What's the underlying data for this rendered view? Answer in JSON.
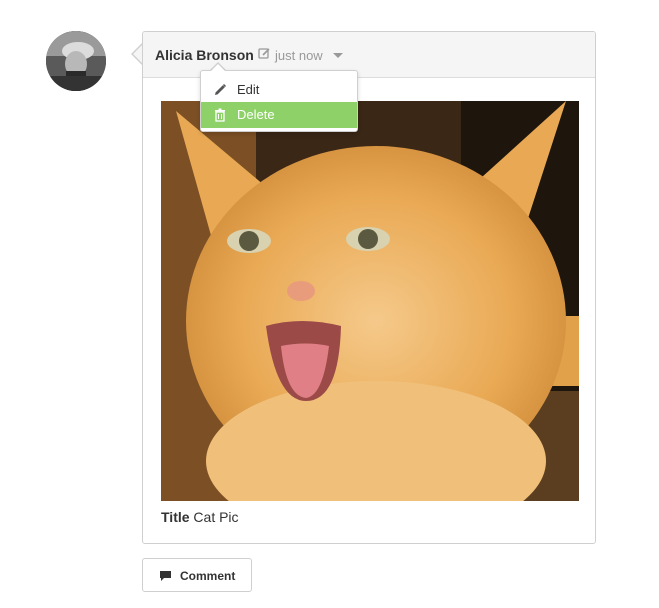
{
  "post": {
    "author": "Alicia Bronson",
    "timestamp": "just now",
    "image_alt": "cat photo",
    "caption_label": "Title",
    "caption_value": "Cat Pic"
  },
  "menu": {
    "items": [
      {
        "label": "Edit",
        "icon": "pencil-icon"
      },
      {
        "label": "Delete",
        "icon": "trash-icon"
      }
    ],
    "highlight_color": "#8ed168"
  },
  "actions": {
    "comment_label": "Comment",
    "comment_icon": "speech-bubble-icon"
  }
}
